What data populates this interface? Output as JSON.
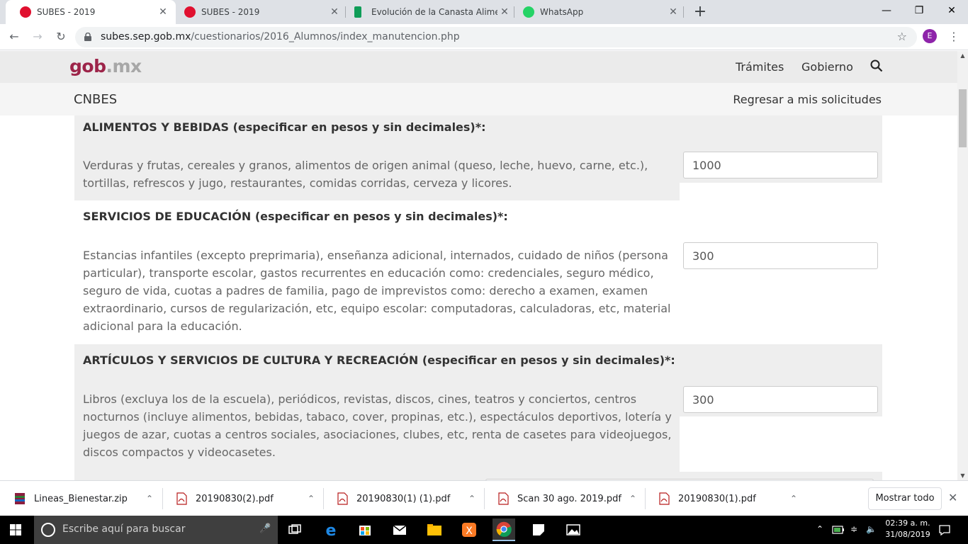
{
  "browser": {
    "tabs": [
      {
        "title": "SUBES - 2019",
        "icon": "subes-favicon-icon",
        "active": true
      },
      {
        "title": "SUBES - 2019",
        "icon": "subes-favicon-icon",
        "active": false
      },
      {
        "title": "Evolución de la Canasta Alimenta",
        "icon": "sheets-favicon-icon",
        "active": false
      },
      {
        "title": "WhatsApp",
        "icon": "whatsapp-favicon-icon",
        "active": false
      }
    ],
    "close_glyph": "✕",
    "new_tab_glyph": "+",
    "url_host": "subes.sep.gob.mx",
    "url_path": "/cuestionarios/2016_Alumnos/index_manutencion.php",
    "profile_initial": "E"
  },
  "site": {
    "logo_main": "gob",
    "logo_suffix": ".mx",
    "nav_tramites": "Trámites",
    "nav_gobierno": "Gobierno",
    "brand": "CNBES",
    "back_link": "Regresar a mis solicitudes",
    "accent_color": "#9d2449"
  },
  "form": {
    "sections": [
      {
        "heading": "ALIMENTOS Y BEBIDAS (especificar en pesos y sin decimales)*:",
        "description": "Verduras y frutas, cereales y granos, alimentos de origen animal (queso, leche, huevo, carne, etc.), tortillas, refrescos y jugo, restaurantes, comidas corridas, cerveza y licores.",
        "value": "1000"
      },
      {
        "heading": "SERVICIOS DE EDUCACIÓN (especificar en pesos y sin decimales)*:",
        "description": "Estancias infantiles (excepto preprimaria), enseñanza adicional, internados, cuidado de niños (persona particular), transporte escolar, gastos recurrentes en educación como: credenciales, seguro médico, seguro de vida, cuotas a padres de familia, pago de imprevistos como: derecho a examen, examen extraordinario, cursos de regularización, etc, equipo escolar: computadoras, calculadoras, etc, material adicional para la educación.",
        "value": "300"
      },
      {
        "heading": "ARTÍCULOS Y SERVICIOS DE CULTURA Y RECREACIÓN (especificar en pesos y sin decimales)*:",
        "description": "Libros (excluya los de la escuela), periódicos, revistas, discos, cines, teatros y conciertos, centros nocturnos (incluye alimentos, bebidas, tabaco, cover, propinas, etc.), espectáculos deportivos, lotería y juegos de azar, cuotas a centros sociales, asociaciones, clubes, etc, renta de casetes para videojuegos, discos compactos y videocasetes.",
        "value": "300"
      }
    ]
  },
  "downloads": {
    "items": [
      {
        "name": "Lineas_Bienestar.zip",
        "icon": "zip-file-icon"
      },
      {
        "name": "20190830(2).pdf",
        "icon": "pdf-file-icon"
      },
      {
        "name": "20190830(1) (1).pdf",
        "icon": "pdf-file-icon"
      },
      {
        "name": "Scan 30 ago. 2019.pdf",
        "icon": "pdf-file-icon"
      },
      {
        "name": "20190830(1).pdf",
        "icon": "pdf-file-icon"
      }
    ],
    "show_all": "Mostrar todo"
  },
  "taskbar": {
    "search_placeholder": "Escribe aquí para buscar",
    "time": "02:39 a. m.",
    "date": "31/08/2019"
  }
}
